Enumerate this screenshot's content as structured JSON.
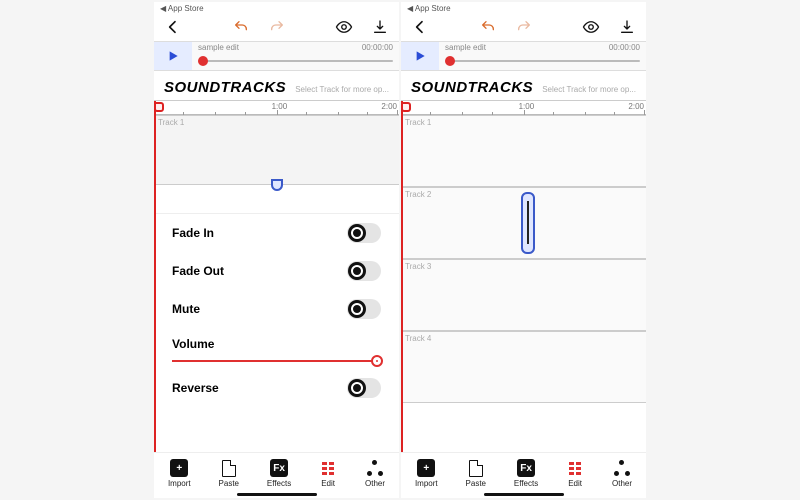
{
  "status_back": "◀ App Store",
  "song": {
    "name": "sample edit",
    "time": "00:00:00"
  },
  "section": {
    "title": "SOUNDTRACKS",
    "hint": "Select Track for more op..."
  },
  "ruler": {
    "labels": [
      "1:00",
      "2:00"
    ]
  },
  "tracks": [
    "Track 1",
    "Track 2",
    "Track 3",
    "Track 4"
  ],
  "edit_panel": {
    "fade_in": "Fade In",
    "fade_out": "Fade Out",
    "mute": "Mute",
    "volume": "Volume",
    "reverse": "Reverse"
  },
  "tabs": {
    "import": "Import",
    "paste": "Paste",
    "effects": "Effects",
    "edit": "Edit",
    "other": "Other"
  }
}
